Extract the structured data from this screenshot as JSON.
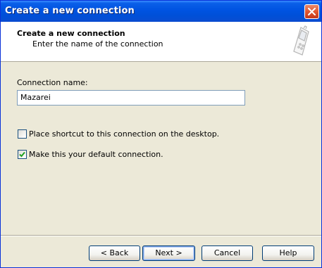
{
  "window": {
    "title": "Create a new connection"
  },
  "header": {
    "title": "Create a new connection",
    "subtitle": "Enter the name of the connection",
    "graphic_icon": "mobile-phone-icon"
  },
  "form": {
    "connection_name_label": "Connection name:",
    "connection_name_value": "Mazarei",
    "shortcut_checkbox": {
      "label": "Place shortcut to this connection on the desktop.",
      "checked": false
    },
    "default_checkbox": {
      "label": "Make this your default connection.",
      "checked": true
    }
  },
  "buttons": {
    "back": "< Back",
    "next": "Next >",
    "cancel": "Cancel",
    "help": "Help"
  },
  "colors": {
    "titlebar": "#0053e1",
    "dialog_bg": "#ece9d8",
    "close_button": "#e2572f",
    "checkmark": "#21a121"
  }
}
